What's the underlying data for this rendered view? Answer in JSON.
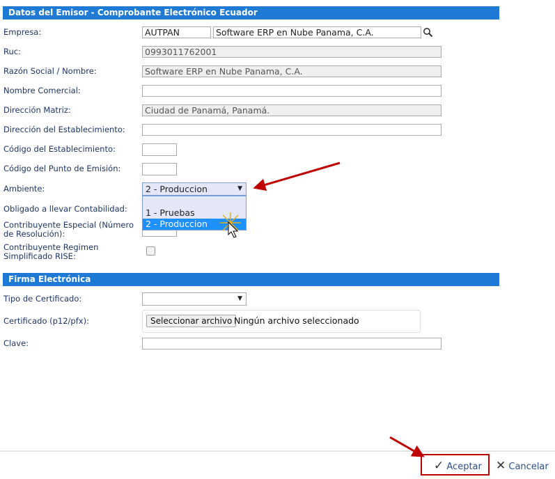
{
  "section1": {
    "title": "Datos del Emisor - Comprobante Electrónico Ecuador"
  },
  "fields": {
    "empresa": {
      "label": "Empresa:",
      "code": "AUTPAN",
      "name": "Software ERP en Nube Panama, C.A."
    },
    "ruc": {
      "label": "Ruc:",
      "value": "0993011762001"
    },
    "razon": {
      "label": "Razón Social / Nombre:",
      "value": "Software ERP en Nube Panama, C.A."
    },
    "nombre_comercial": {
      "label": "Nombre Comercial:",
      "value": ""
    },
    "direccion_matriz": {
      "label": "Dirección Matriz:",
      "value": "Ciudad de Panamá, Panamá."
    },
    "direccion_estab": {
      "label": "Dirección del Establecimiento:",
      "value": ""
    },
    "codigo_estab": {
      "label": "Código del Establecimiento:",
      "value": ""
    },
    "codigo_punto": {
      "label": "Código del Punto de Emisión:",
      "value": ""
    },
    "ambiente": {
      "label": "Ambiente:",
      "selected": "2 - Produccion",
      "options": [
        "",
        "1 - Pruebas",
        "2 - Produccion"
      ]
    },
    "obligado": {
      "label": "Obligado a llevar Contabilidad:"
    },
    "contribuyente_especial": {
      "label": "Contribuyente Especial (Número de Resolución):"
    },
    "rise": {
      "label": "Contribuyente Regimen Simplificado RISE:",
      "checked": false
    }
  },
  "section2": {
    "title": "Firma Electrónica"
  },
  "firma": {
    "tipo": {
      "label": "Tipo de Certificado:",
      "selected": ""
    },
    "certificado": {
      "label": "Certificado (p12/pfx):",
      "button": "Seleccionar archivo",
      "status": "Ningún archivo seleccionado"
    },
    "clave": {
      "label": "Clave:",
      "value": ""
    }
  },
  "footer": {
    "accept": "Aceptar",
    "cancel": "Cancelar"
  },
  "colors": {
    "header": "#1f7ad6",
    "highlight": "#1e90ff",
    "annotation": "#c00000"
  }
}
